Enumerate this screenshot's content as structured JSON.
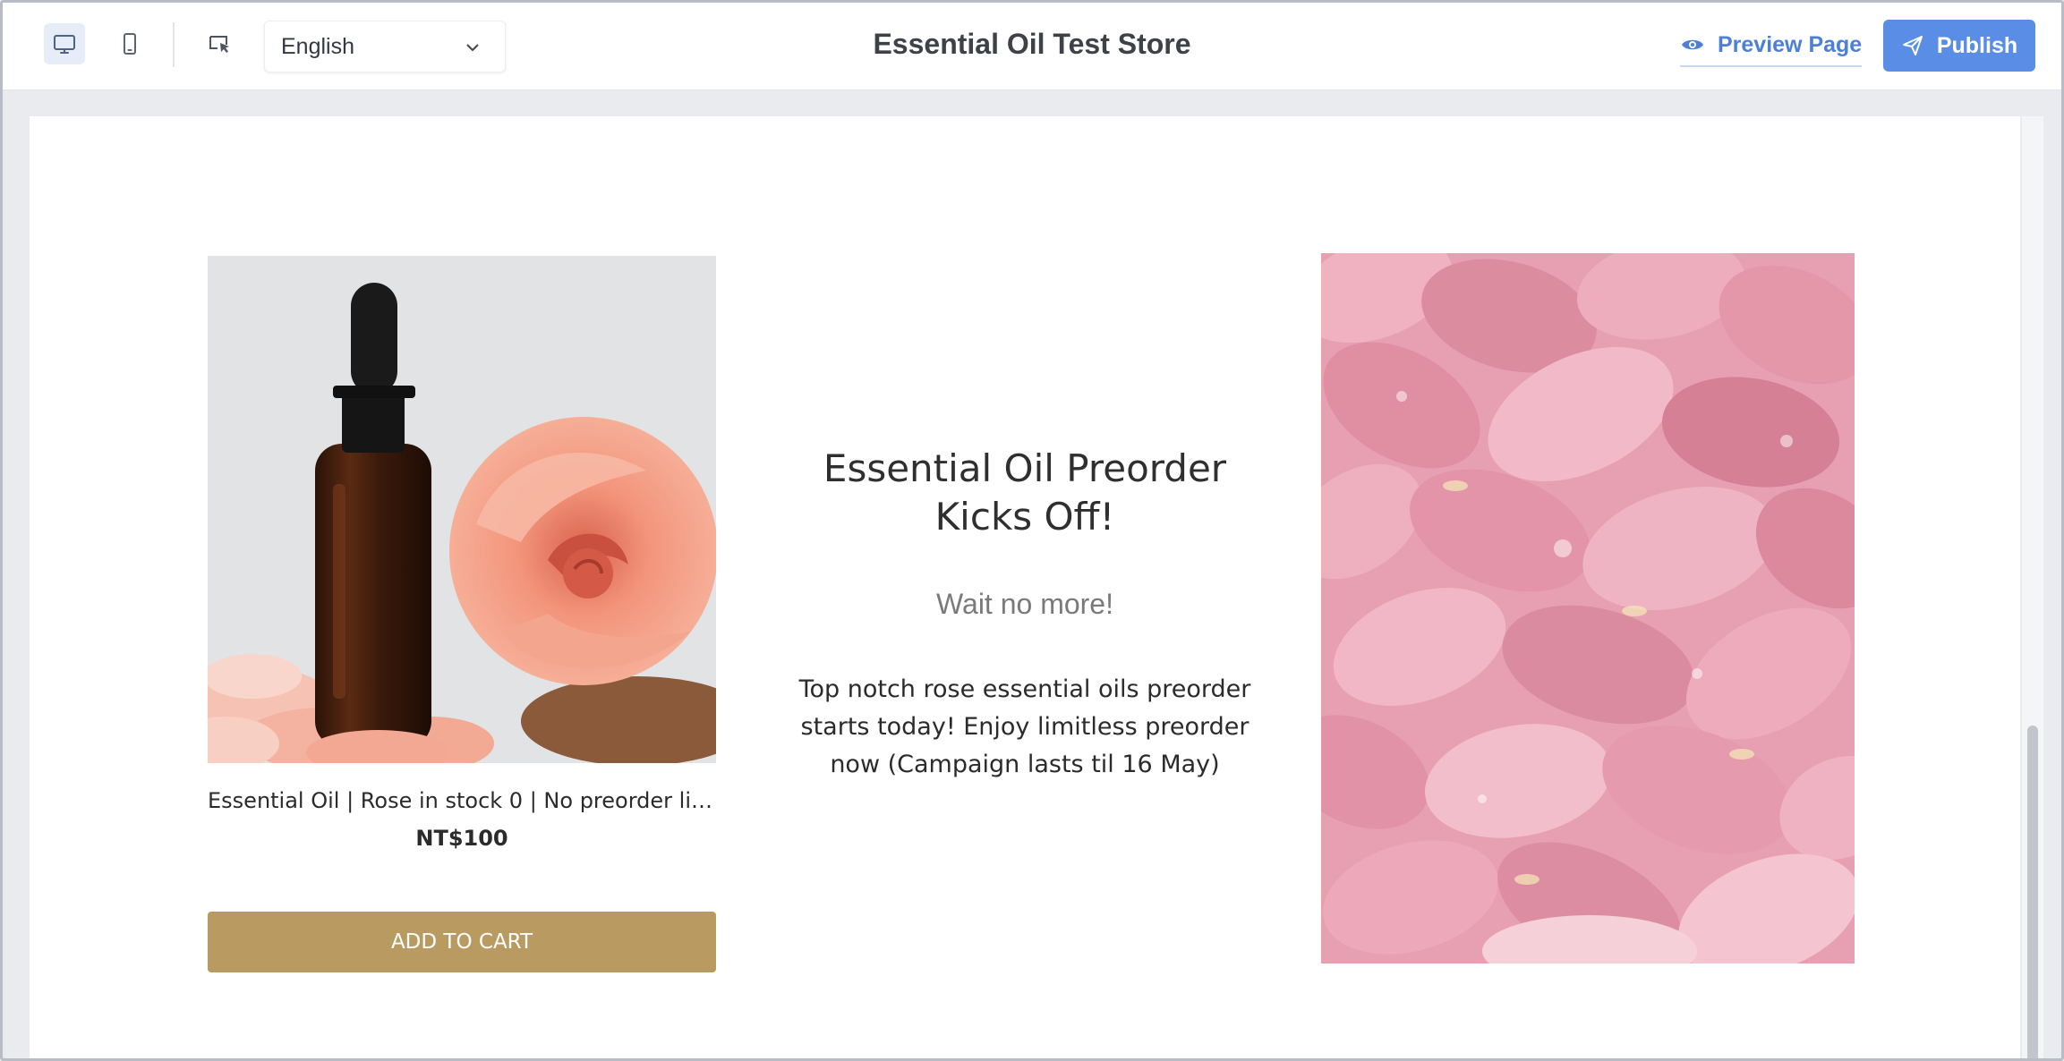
{
  "toolbar": {
    "language": "English",
    "store_title": "Essential Oil Test Store",
    "preview_label": "Preview Page",
    "publish_label": "Publish"
  },
  "product": {
    "name": "Essential Oil | Rose in stock 0 | No preorder limit...",
    "price": "NT$100",
    "cta_label": "ADD TO CART"
  },
  "campaign": {
    "headline": "Essential Oil Preorder Kicks Off!",
    "subheadline": "Wait no more!",
    "body": "Top notch rose essential oils preorder starts today! Enjoy limitless preorder  now (Campaign lasts til 16 May)"
  },
  "colors": {
    "accent": "#5a8ee6",
    "button": "#b99b62"
  }
}
